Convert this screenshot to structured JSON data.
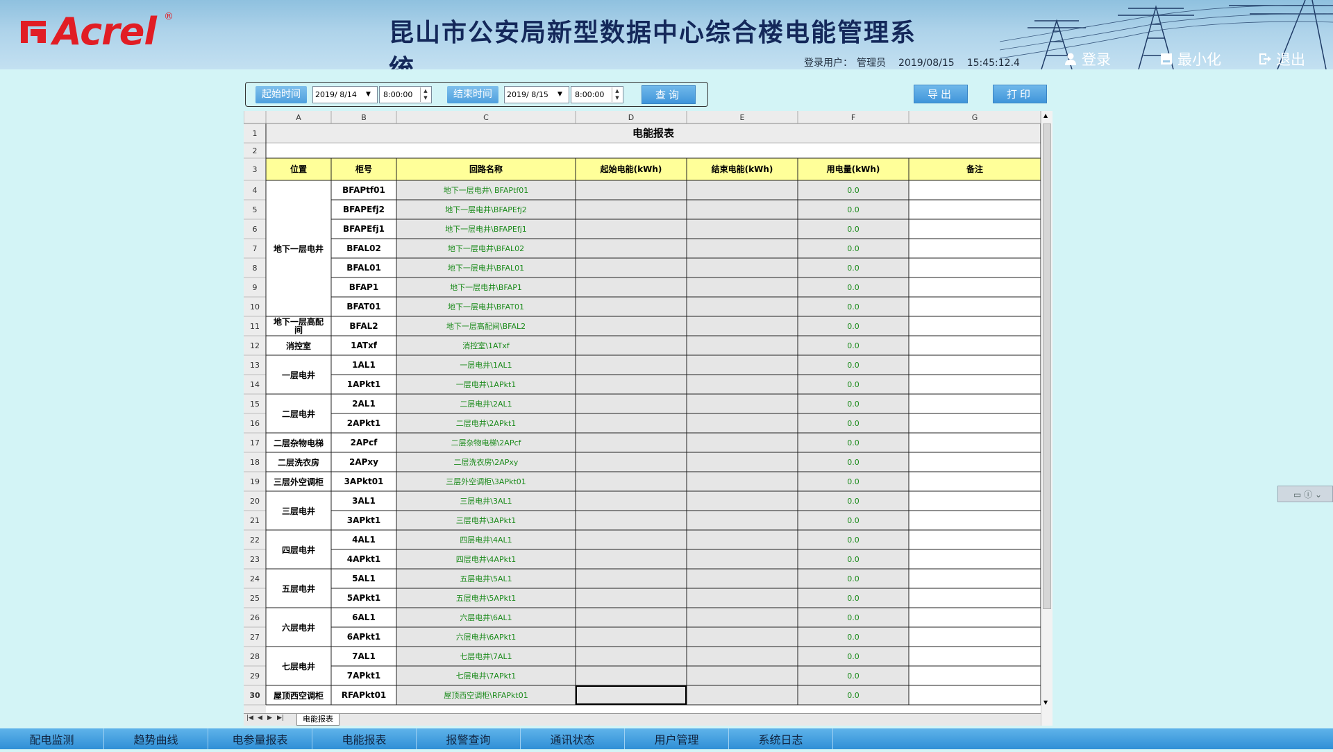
{
  "header": {
    "logo_text": "Acrel",
    "logo_reg": "®",
    "title": "昆山市公安局新型数据中心综合楼电能管理系统",
    "user_label": "登录用户：",
    "user_name": "管理员",
    "date": "2019/08/15",
    "time": "15:45:12.4",
    "buttons": {
      "login": "登录",
      "minimize": "最小化",
      "logout": "退出"
    }
  },
  "toolbar": {
    "start_label": "起始时间",
    "start_date": "2019/ 8/14",
    "start_time": "8:00:00",
    "end_label": "结束时间",
    "end_date": "2019/ 8/15",
    "end_time": "8:00:00",
    "query_label": "查询",
    "export_label": "导出",
    "print_label": "打印"
  },
  "sheet": {
    "col_letters": [
      "A",
      "B",
      "C",
      "D",
      "E",
      "F",
      "G"
    ],
    "title": "电能报表",
    "headers": [
      "位置",
      "柜号",
      "回路名称",
      "起始电能(kWh)",
      "结束电能(kWh)",
      "用电量(kWh)",
      "备注"
    ],
    "rows": [
      {
        "cab": "BFAPtf01",
        "circuit": "地下一层电井\\ BFAPtf01",
        "usage": "0.0"
      },
      {
        "cab": "BFAPEfj2",
        "circuit": "地下一层电井\\BFAPEfj2",
        "usage": "0.0"
      },
      {
        "cab": "BFAPEfj1",
        "circuit": "地下一层电井\\BFAPEfj1",
        "usage": "0.0"
      },
      {
        "cab": "BFAL02",
        "circuit": "地下一层电井\\BFAL02",
        "usage": "0.0"
      },
      {
        "cab": "BFAL01",
        "circuit": "地下一层电井\\BFAL01",
        "usage": "0.0"
      },
      {
        "cab": "BFAP1",
        "circuit": "地下一层电井\\BFAP1",
        "usage": "0.0"
      },
      {
        "cab": "BFAT01",
        "circuit": "地下一层电井\\BFAT01",
        "usage": "0.0"
      },
      {
        "cab": "BFAL2",
        "circuit": "地下一层高配间\\BFAL2",
        "usage": "0.0"
      },
      {
        "cab": "1ATxf",
        "circuit": "消控室\\1ATxf",
        "usage": "0.0"
      },
      {
        "cab": "1AL1",
        "circuit": "一层电井\\1AL1",
        "usage": "0.0"
      },
      {
        "cab": "1APkt1",
        "circuit": "一层电井\\1APkt1",
        "usage": "0.0"
      },
      {
        "cab": "2AL1",
        "circuit": "二层电井\\2AL1",
        "usage": "0.0"
      },
      {
        "cab": "2APkt1",
        "circuit": "二层电井\\2APkt1",
        "usage": "0.0"
      },
      {
        "cab": "2APcf",
        "circuit": "二层杂物电梯\\2APcf",
        "usage": "0.0"
      },
      {
        "cab": "2APxy",
        "circuit": "二层洗衣房\\2APxy",
        "usage": "0.0"
      },
      {
        "cab": "3APkt01",
        "circuit": "三层外空调柜\\3APkt01",
        "usage": "0.0"
      },
      {
        "cab": "3AL1",
        "circuit": "三层电井\\3AL1",
        "usage": "0.0"
      },
      {
        "cab": "3APkt1",
        "circuit": "三层电井\\3APkt1",
        "usage": "0.0"
      },
      {
        "cab": "4AL1",
        "circuit": "四层电井\\4AL1",
        "usage": "0.0"
      },
      {
        "cab": "4APkt1",
        "circuit": "四层电井\\4APkt1",
        "usage": "0.0"
      },
      {
        "cab": "5AL1",
        "circuit": "五层电井\\5AL1",
        "usage": "0.0"
      },
      {
        "cab": "5APkt1",
        "circuit": "五层电井\\5APkt1",
        "usage": "0.0"
      },
      {
        "cab": "6AL1",
        "circuit": "六层电井\\6AL1",
        "usage": "0.0"
      },
      {
        "cab": "6APkt1",
        "circuit": "六层电井\\6APkt1",
        "usage": "0.0"
      },
      {
        "cab": "7AL1",
        "circuit": "七层电井\\7AL1",
        "usage": "0.0"
      },
      {
        "cab": "7APkt1",
        "circuit": "七层电井\\7APkt1",
        "usage": "0.0"
      },
      {
        "cab": "RFAPkt01",
        "circuit": "屋顶西空调柜\\RFAPkt01",
        "usage": "0.0"
      }
    ],
    "locations": [
      {
        "label": "地下一层电井",
        "start": 0,
        "span": 7
      },
      {
        "label": "地下一层高配间",
        "start": 7,
        "span": 1
      },
      {
        "label": "消控室",
        "start": 8,
        "span": 1
      },
      {
        "label": "一层电井",
        "start": 9,
        "span": 2
      },
      {
        "label": "二层电井",
        "start": 11,
        "span": 2
      },
      {
        "label": "二层杂物电梯",
        "start": 13,
        "span": 1
      },
      {
        "label": "二层洗衣房",
        "start": 14,
        "span": 1
      },
      {
        "label": "三层外空调柜",
        "start": 15,
        "span": 1
      },
      {
        "label": "三层电井",
        "start": 16,
        "span": 2
      },
      {
        "label": "四层电井",
        "start": 18,
        "span": 2
      },
      {
        "label": "五层电井",
        "start": 20,
        "span": 2
      },
      {
        "label": "六层电井",
        "start": 22,
        "span": 2
      },
      {
        "label": "七层电井",
        "start": 24,
        "span": 2
      },
      {
        "label": "屋顶西空调柜",
        "start": 26,
        "span": 1
      }
    ],
    "tab_label": "电能报表"
  },
  "nav": [
    "配电监测",
    "趋势曲线",
    "电参量报表",
    "电能报表",
    "报警查询",
    "通讯状态",
    "用户管理",
    "系统日志"
  ],
  "colors": {
    "header_yellow": "#ffff99",
    "cell_gray": "#e6e6e6",
    "circuit_green": "#1a8a1a",
    "nav_blue": "#3b98db"
  }
}
